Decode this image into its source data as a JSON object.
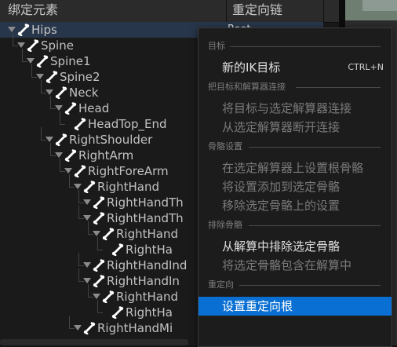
{
  "header": {
    "col1": "绑定元素",
    "col2": "重定向链"
  },
  "tree": [
    {
      "label": "Hips",
      "depth": 0,
      "caret": true,
      "selected": true,
      "chain": "Root"
    },
    {
      "label": "Spine",
      "depth": 1,
      "caret": true
    },
    {
      "label": "Spine1",
      "depth": 2,
      "caret": true
    },
    {
      "label": "Spine2",
      "depth": 3,
      "caret": true
    },
    {
      "label": "Neck",
      "depth": 4,
      "caret": true
    },
    {
      "label": "Head",
      "depth": 5,
      "caret": true
    },
    {
      "label": "HeadTop_End",
      "depth": 6,
      "caret": false
    },
    {
      "label": "RightShoulder",
      "depth": 4,
      "caret": true
    },
    {
      "label": "RightArm",
      "depth": 5,
      "caret": true
    },
    {
      "label": "RightForeArm",
      "depth": 6,
      "caret": true
    },
    {
      "label": "RightHand",
      "depth": 7,
      "caret": true
    },
    {
      "label": "RightHandTh",
      "depth": 8,
      "caret": true
    },
    {
      "label": "RightHandTh",
      "depth": 8,
      "caret": true
    },
    {
      "label": "RightHand",
      "depth": 9,
      "caret": true
    },
    {
      "label": "RightHa",
      "depth": 10,
      "caret": false
    },
    {
      "label": "RightHandInd",
      "depth": 8,
      "caret": true
    },
    {
      "label": "RightHandIn",
      "depth": 8,
      "caret": true
    },
    {
      "label": "RightHand",
      "depth": 9,
      "caret": true
    },
    {
      "label": "RightHa",
      "depth": 10,
      "caret": false
    },
    {
      "label": "RightHandMi",
      "depth": 7,
      "caret": true
    }
  ],
  "menu": {
    "sections": [
      {
        "title": "目标",
        "items": [
          {
            "label": "新的IK目标",
            "shortcut": "CTRL+N",
            "enabled": true
          }
        ]
      },
      {
        "title": "把目标和解算器连接",
        "items": [
          {
            "label": "将目标与选定解算器连接",
            "enabled": false
          },
          {
            "label": "从选定解算器断开连接",
            "enabled": false
          }
        ]
      },
      {
        "title": "骨骼设置",
        "items": [
          {
            "label": "在选定解算器上设置根骨骼",
            "enabled": false
          },
          {
            "label": "将设置添加到选定骨骼",
            "enabled": false
          },
          {
            "label": "移除选定骨骼上的设置",
            "enabled": false
          }
        ]
      },
      {
        "title": "排除骨骼",
        "items": [
          {
            "label": "从解算中排除选定骨骼",
            "enabled": true
          },
          {
            "label": "将选定骨骼包含在解算中",
            "enabled": false
          }
        ]
      },
      {
        "title": "重定向",
        "items": [
          {
            "label": "设置重定向根",
            "enabled": true,
            "highlighted": true
          }
        ]
      }
    ]
  },
  "colors": {
    "highlight": "#0a6fd2",
    "selected_row": "#27364a",
    "panel": "#1a1a1a"
  },
  "icons": {
    "bone": "bone-icon",
    "caret": "caret-down-icon"
  }
}
